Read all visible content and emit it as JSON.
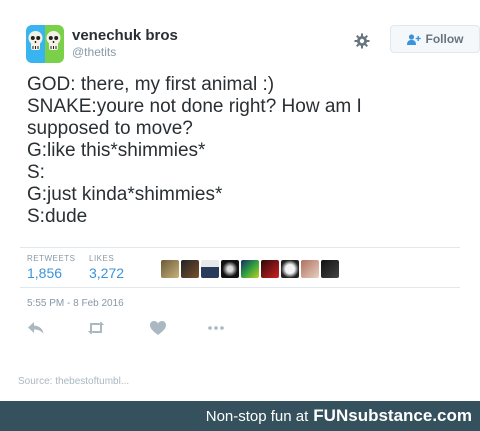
{
  "account": {
    "display_name": "venechuk bros",
    "handle": "@thetits",
    "avatar_icon": "skulls-icon",
    "follow_label": "Follow"
  },
  "tweet": {
    "lines": [
      "GOD: there, my first animal :)",
      "SNAKE:youre not done right? How am I",
      "supposed to move?",
      "G:like this*shimmies*",
      "S:",
      "G:just kinda*shimmies*",
      "S:dude"
    ],
    "timestamp": "5:55 PM - 8 Feb 2016"
  },
  "stats": {
    "retweets_label": "RETWEETS",
    "retweets_count": "1,856",
    "likes_label": "LIKES",
    "likes_count": "3,272"
  },
  "actions": [
    "reply-icon",
    "retweet-icon",
    "like-icon",
    "more-icon"
  ],
  "source": "Source: thebestoftumbl...",
  "footer": {
    "tagline": "Non-stop fun at",
    "brand": "FUNsubstance.com"
  },
  "colors": {
    "link_blue": "#3b94d9",
    "muted": "#8899a6",
    "footer_bg": "#35515d"
  }
}
